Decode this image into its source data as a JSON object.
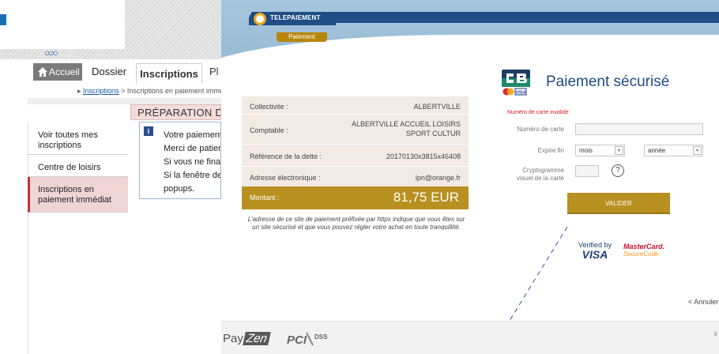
{
  "portal": {
    "tabs": {
      "home": "Accueil",
      "dossier": "Dossier",
      "inscriptions": "Inscriptions",
      "next": "Pl"
    },
    "breadcrumb": {
      "link": "Inscriptions",
      "separator": ">",
      "current": "Inscriptions en paiement immé"
    },
    "section_title": "PRÉPARATION DU",
    "info_lines": [
      "Votre paiement",
      "Merci de patient",
      "Si vous ne finali",
      "Si la fenêtre de",
      "popups."
    ],
    "nav": [
      "Voir toutes mes inscriptions",
      "Centre de loisirs",
      "Inscriptions en paiement immédiat"
    ]
  },
  "payment": {
    "header_title": "TELEPAIEMENT",
    "header_subtab": "Paiement",
    "summary": {
      "collectivite_label": "Collectivite :",
      "collectivite_value": "ALBERTVILLE",
      "comptable_label": "Comptable :",
      "comptable_value_1": "ALBERTVILLE ACCUEIL LOISIRS",
      "comptable_value_2": "SPORT CULTUR",
      "ref_label": "Référence de la dette :",
      "ref_value": "20170130x3815x46408",
      "email_label": "Adresse électronique :",
      "email_value": "lpn@orange.fr",
      "amount_label": "Montant :",
      "amount_value": "81,75 EUR"
    },
    "note": "L'adresse de ce site de paiement préfixée par https indique que vous êtes sur un site sécurisé et que vous pouvez régler votre achat en toute tranquillité.",
    "form": {
      "title": "Paiement sécurisé",
      "error": "Numéro de carte invalide",
      "card_label": "Numéro de carte",
      "card_value": "",
      "expiry_label": "Expire fin",
      "month_value": "mois",
      "year_value": "année",
      "cvv_label_1": "Cryptogramme",
      "cvv_label_2": "visuel de la carte",
      "cvv_value": "",
      "help": "?",
      "submit": "VALIDER"
    },
    "badges": {
      "vbv_1": "Verified by",
      "vbv_2": "VISA",
      "mc_1": "MasterCard.",
      "mc_2": "SecureCode."
    },
    "cancel": "< Annuler",
    "footer": {
      "payzen_1": "Pay",
      "payzen_2": "Zen",
      "pci": "PCI",
      "dss": "DSS",
      "edge": "ir"
    },
    "colors": {
      "navy": "#1f4d86",
      "gold": "#b8901f",
      "error": "#d12020"
    }
  }
}
